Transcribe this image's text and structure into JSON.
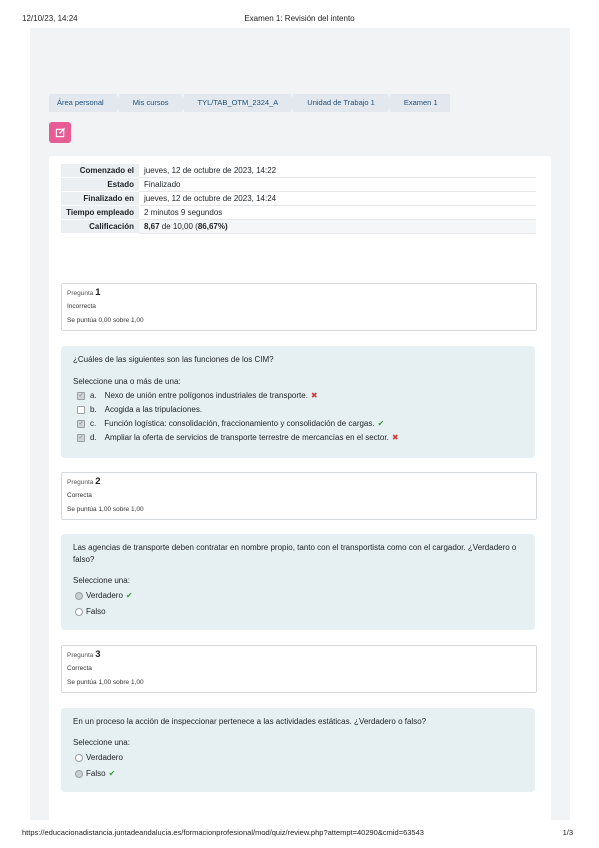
{
  "print": {
    "date": "12/10/23, 14:24",
    "title": "Examen 1: Revisión del intento",
    "url": "https://educacionadistancia.juntadeandalucia.es/formacionprofesional/mod/quiz/review.php?attempt=40290&cmid=63543",
    "page": "1/3"
  },
  "breadcrumb": [
    "Área personal",
    "Mis cursos",
    "TYL/TAB_OTM_2324_A",
    "Unidad de Trabajo 1",
    "Examen 1"
  ],
  "edit_button": {
    "icon": "edit-icon"
  },
  "summary": {
    "started_label": "Comenzado el",
    "started_value": "jueves, 12 de octubre de 2023, 14:22",
    "state_label": "Estado",
    "state_value": "Finalizado",
    "finished_label": "Finalizado en",
    "finished_value": "jueves, 12 de octubre de 2023, 14:24",
    "time_label": "Tiempo empleado",
    "time_value": "2 minutos 9 segundos",
    "grade_label": "Calificación",
    "grade_score": "8,67",
    "grade_rest": " de 10,00 (",
    "grade_pct": "86,67%",
    "grade_close": ")"
  },
  "questions": [
    {
      "label": "Pregunta",
      "number": "1",
      "state": "Incorrecta",
      "grade": "Se puntúa 0,00 sobre 1,00",
      "prompt": "¿Cuáles de las siguientes son las funciones de los CIM?",
      "instruction": "Seleccione una o más de una:",
      "options": [
        {
          "letter": "a.",
          "text": "Nexo de unión entre polígonos industriales de transporte.",
          "mark": "✖"
        },
        {
          "letter": "b.",
          "text": "Acogida a las tripulaciones.",
          "mark": ""
        },
        {
          "letter": "c.",
          "text": "Función logística: consolidación, fraccionamiento y consolidación de cargas.",
          "mark": "✔"
        },
        {
          "letter": "d.",
          "text": "Ampliar la oferta de servicios de transporte terrestre de mercancías en el sector.",
          "mark": "✖"
        }
      ]
    },
    {
      "label": "Pregunta",
      "number": "2",
      "state": "Correcta",
      "grade": "Se puntúa 1,00 sobre 1,00",
      "prompt": "Las agencias de transporte deben contratar en nombre propio, tanto con el transportista como con el cargador. ¿Verdadero o falso?",
      "instruction": "Seleccione una:",
      "options": [
        {
          "text": "Verdadero",
          "mark": "✔"
        },
        {
          "text": "Falso",
          "mark": ""
        }
      ]
    },
    {
      "label": "Pregunta",
      "number": "3",
      "state": "Correcta",
      "grade": "Se puntúa 1,00 sobre 1,00",
      "prompt": "En un proceso la acción de inspeccionar pertenece a las actividades estáticas. ¿Verdadero o falso?",
      "instruction": "Seleccione una:",
      "options": [
        {
          "text": "Verdadero",
          "mark": ""
        },
        {
          "text": "Falso",
          "mark": "✔"
        }
      ]
    }
  ],
  "colors": {
    "correct": "#3a9c3a",
    "incorrect": "#d43c3c",
    "edit_button": "#e85c96",
    "question_bg": "#e6f0f3"
  }
}
